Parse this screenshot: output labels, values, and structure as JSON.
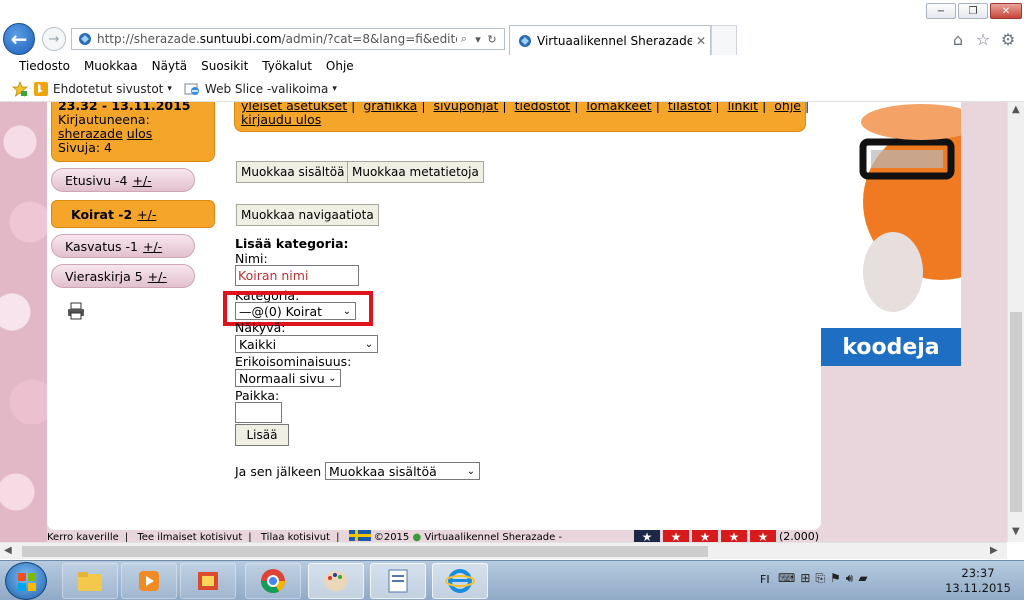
{
  "window": {
    "minimize_glyph": "−",
    "maximize_glyph": "❐",
    "close_glyph": "✕"
  },
  "navigation": {
    "back_glyph": "←",
    "forward_glyph": "→",
    "url_prefix": "http://sherazade.",
    "url_domain": "suntuubi.com",
    "url_rest": "/admin/?cat=8&lang=fi&editcat=18",
    "search_glyph": "⌕",
    "refresh_glyph": "↻",
    "tab_title": "Virtuaalikennel Sherazade",
    "tab_close_glyph": "✕",
    "home_glyph": "⌂",
    "favorites_glyph": "☆",
    "tools_glyph": "⚙"
  },
  "menubar": {
    "items": [
      "Tiedosto",
      "Muokkaa",
      "Näytä",
      "Suosikit",
      "Työkalut",
      "Ohje"
    ]
  },
  "favorites_bar": {
    "suggested_sites": "Ehdotetut sivustot",
    "web_slice": "Web Slice -valikoima",
    "caret": "▾"
  },
  "page": {
    "userbox": {
      "time": "23.32 - 13.11.2015",
      "logged_in_label": "Kirjautuneena:",
      "username": "sherazade",
      "logout": "ulos",
      "pages": "Sivuja: 4"
    },
    "nav": [
      {
        "label": "Etusivu -4",
        "action": "+/-"
      },
      {
        "label": "Koirat -2",
        "action": "+/-"
      },
      {
        "label": "Kasvatus -1",
        "action": "+/-"
      },
      {
        "label": "Vieraskirja 5",
        "action": "+/-"
      }
    ],
    "topmenu": {
      "links": [
        "yleiset asetukset",
        "grafiikka",
        "sivupohjat",
        "tiedostot",
        "lomakkeet",
        "tilastot",
        "linkit",
        "ohje"
      ],
      "separator": "|",
      "logout": "kirjaudu ulos"
    },
    "buttons": {
      "edit_content": "Muokkaa sisältöä",
      "edit_meta": "Muokkaa metatietoja",
      "edit_nav": "Muokkaa navigaatiota"
    },
    "form": {
      "heading": "Lisää kategoria:",
      "name_label": "Nimi:",
      "name_value": "Koiran nimi",
      "category_label": "Kategoria:",
      "category_value": "—@(0) Koirat",
      "view_label": "Näkyvä:",
      "view_value": "Kaikki",
      "special_label": "Erikoisominaisuus:",
      "special_value": "Normaali sivu",
      "place_label": "Paikka:",
      "place_value": "",
      "submit": "Lisää",
      "after_label": "Ja sen jälkeen",
      "after_value": "Muokkaa sisältöä",
      "select_arrow": "⌄"
    },
    "footer": {
      "links": [
        "Kerro kaverille",
        "Tee ilmaiset kotisivut",
        "Tilaa kotisivut"
      ],
      "copyright": "©2015",
      "bullet": "●",
      "site": "Virtuaalikennel Sherazade -",
      "rating_count": "(2.000)"
    },
    "ad": {
      "label": "koodeja"
    },
    "stars": [
      "★",
      "★",
      "★",
      "★",
      "★"
    ]
  },
  "taskbar": {
    "language": "FI",
    "time": "23:37",
    "date": "13.11.2015"
  },
  "colors": {
    "orange": "#f5a52a",
    "pink": "#e2c0ce",
    "highlight": "#e0121b",
    "ad_blue": "#1e6fc4"
  }
}
